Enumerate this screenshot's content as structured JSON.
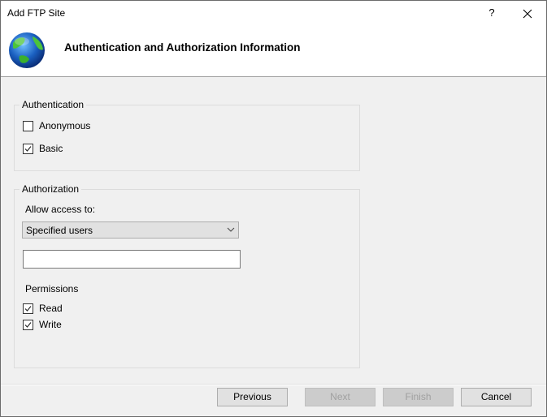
{
  "window": {
    "title": "Add FTP Site",
    "help_label": "?",
    "close_label": "✕"
  },
  "header": {
    "icon": "globe-icon",
    "title": "Authentication and Authorization Information"
  },
  "authentication": {
    "legend": "Authentication",
    "options": [
      {
        "label": "Anonymous",
        "checked": false
      },
      {
        "label": "Basic",
        "checked": true
      }
    ]
  },
  "authorization": {
    "legend": "Authorization",
    "allow_access_label": "Allow access to:",
    "allow_access_value": "Specified users",
    "users_input_value": "",
    "permissions_label": "Permissions",
    "permissions": [
      {
        "label": "Read",
        "checked": true
      },
      {
        "label": "Write",
        "checked": true
      }
    ]
  },
  "buttons": {
    "previous": "Previous",
    "next": "Next",
    "finish": "Finish",
    "cancel": "Cancel"
  }
}
